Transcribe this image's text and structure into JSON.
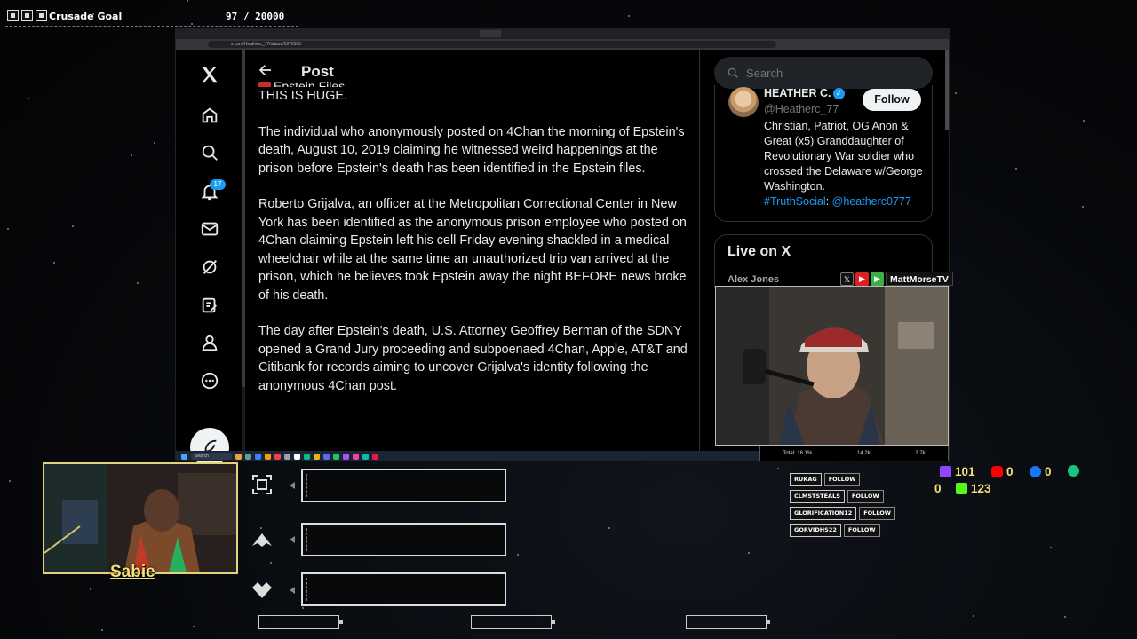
{
  "overlay": {
    "goal_title": "Crusade Goal",
    "goal_count": "97 / 20000",
    "streamer_name": "Sabie",
    "cam_tag": "MattMorseTV",
    "cam_stats": [
      "Total: 16.1%",
      "14.2k",
      "2.7k"
    ],
    "counters": {
      "twitch": "101",
      "youtube": "0",
      "facebook": "0",
      "other": "0",
      "kick": "123"
    },
    "followers": [
      {
        "name": "RUKAG",
        "action": "FOLLOW"
      },
      {
        "name": "CLMSTSTEALS",
        "action": "FOLLOW"
      },
      {
        "name": "GLORIFICATION12",
        "action": "FOLLOW"
      },
      {
        "name": "GORVIDHS22",
        "action": "FOLLOW"
      }
    ]
  },
  "browser": {
    "url": "x.com/Heatherc_77/status/1976105"
  },
  "x": {
    "nav": {
      "notification_count": "17"
    },
    "post": {
      "header_title": "Post",
      "cut_line": "Epstein Files",
      "paragraphs": [
        "THIS IS HUGE.",
        "The individual who anonymously posted on 4Chan the morning of Epstein's death, August 10, 2019 claiming he witnessed weird happenings at the prison before Epstein's death has been identified in the Epstein files.",
        "Roberto Grijalva, an officer at the Metropolitan Correctional Center in New York has been identified as the anonymous prison employee who posted on 4Chan claiming Epstein left his cell Friday evening shackled in a medical wheelchair while at the same time an unauthorized trip van arrived at the prison, which he believes took Epstein away the night BEFORE news broke of his death.",
        "The day after Epstein's death, U.S. Attorney Geoffrey Berman of the SDNY opened a Grand Jury proceeding and subpoenaed 4Chan, Apple, AT&T and Citibank for records aiming to uncover Grijalva's identity following the anonymous 4Chan post."
      ]
    },
    "search_placeholder": "Search",
    "profile": {
      "name": "HEATHER C.",
      "handle": "@Heatherc_77",
      "follow_label": "Follow",
      "bio": "Christian, Patriot, OG Anon & Great (x5) Granddaughter of Revolutionary War soldier who crossed the Delaware w/George Washington.",
      "bio_tag": "#TruthSocial",
      "bio_sep": ": ",
      "bio_handle": "@heatherc0777"
    },
    "live": {
      "title": "Live on X",
      "first_user": "Alex Jones"
    }
  },
  "taskbar": {
    "search_label": "Search"
  }
}
